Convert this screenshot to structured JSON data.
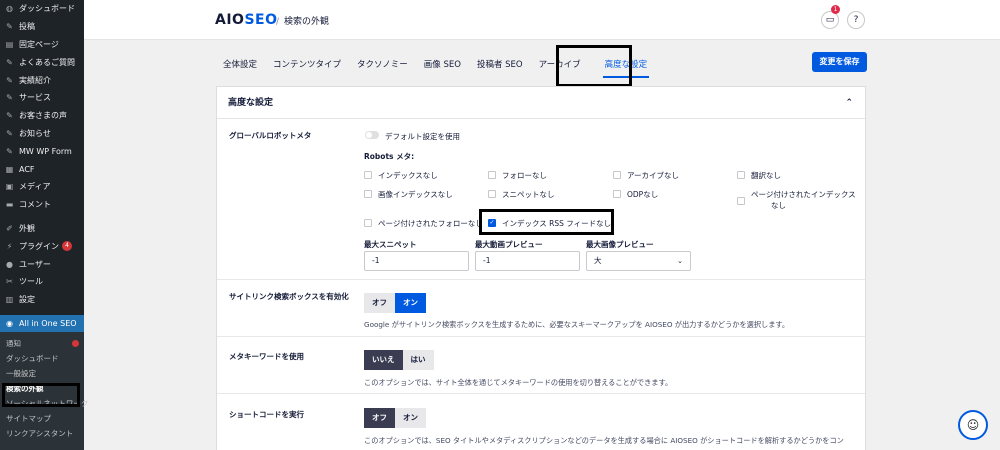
{
  "wp_menu": {
    "items": [
      {
        "label": "ダッシュボード",
        "icon": "dashboard-icon",
        "glyph": "◍"
      },
      {
        "label": "投稿",
        "icon": "pin-icon",
        "glyph": "✎"
      },
      {
        "label": "固定ページ",
        "icon": "page-icon",
        "glyph": "▤"
      },
      {
        "label": "よくあるご質問",
        "icon": "pin-icon",
        "glyph": "✎"
      },
      {
        "label": "実績紹介",
        "icon": "pin-icon",
        "glyph": "✎"
      },
      {
        "label": "サービス",
        "icon": "pin-icon",
        "glyph": "✎"
      },
      {
        "label": "お客さまの声",
        "icon": "pin-icon",
        "glyph": "✎"
      },
      {
        "label": "お知らせ",
        "icon": "pin-icon",
        "glyph": "✎"
      },
      {
        "label": "MW WP Form",
        "icon": "pin-icon",
        "glyph": "✎"
      },
      {
        "label": "ACF",
        "icon": "acf-icon",
        "glyph": "▦"
      },
      {
        "label": "メディア",
        "icon": "media-icon",
        "glyph": "▣"
      },
      {
        "label": "コメント",
        "icon": "comment-icon",
        "glyph": "▬"
      },
      {
        "label": "外観",
        "icon": "appearance-icon",
        "glyph": "✐"
      },
      {
        "label": "プラグイン",
        "icon": "plugin-icon",
        "glyph": "⚡",
        "badge": "4"
      },
      {
        "label": "ユーザー",
        "icon": "user-icon",
        "glyph": "●"
      },
      {
        "label": "ツール",
        "icon": "tool-icon",
        "glyph": "✂"
      },
      {
        "label": "設定",
        "icon": "settings-icon",
        "glyph": "▥"
      },
      {
        "label": "All in One SEO",
        "icon": "aioseo-icon",
        "glyph": "◉"
      }
    ],
    "submenu": [
      "通知",
      "ダッシュボード",
      "一般設定",
      "検索の外観",
      "ソーシャルネットワーク",
      "サイトマップ",
      "リンクアシスタント"
    ]
  },
  "header": {
    "logo_main": "AIO",
    "logo_accent": "SEO",
    "separator": "/",
    "breadcrumb": "検索の外観",
    "notification_count": "1",
    "inbox_glyph": "▭",
    "help_glyph": "?"
  },
  "tabs": [
    "全体設定",
    "コンテンツタイプ",
    "タクソノミー",
    "画像 SEO",
    "投稿者 SEO",
    "アーカイブ",
    "高度な設定"
  ],
  "save_button": "変更を保存",
  "card": {
    "title": "高度な設定",
    "collapse_glyph": "⌃",
    "robots": {
      "label": "グローバルロボットメタ",
      "default_toggle": "デフォルト設定を使用",
      "robots_label": "Robots メタ:",
      "checkboxes": [
        {
          "label": "インデックスなし",
          "checked": false
        },
        {
          "label": "フォローなし",
          "checked": false
        },
        {
          "label": "アーカイブなし",
          "checked": false
        },
        {
          "label": "翻訳なし",
          "checked": false
        },
        {
          "label": "画像インデックスなし",
          "checked": false
        },
        {
          "label": "スニペットなし",
          "checked": false
        },
        {
          "label": "ODPなし",
          "checked": false
        },
        {
          "label": "ページ付けされたインデックス",
          "label2": "なし",
          "checked": false
        },
        {
          "label": "ページ付けされたフォローなし",
          "checked": false
        },
        {
          "label": "インデックス RSS フィードなし",
          "checked": true
        }
      ],
      "max_snippet_label": "最大スニペット",
      "max_snippet_value": "-1",
      "max_video_label": "最大動画プレビュー",
      "max_video_value": "-1",
      "max_image_label": "最大画像プレビュー",
      "max_image_value": "大",
      "dropdown_glyph": "⌄"
    },
    "sitelinks": {
      "label": "サイトリンク検索ボックスを有効化",
      "off": "オフ",
      "on": "オン",
      "help": "Google がサイトリンク検索ボックスを生成するために、必要なスキーマークアップを AIOSEO が出力するかどうかを選択します。"
    },
    "meta_keywords": {
      "label": "メタキーワードを使用",
      "no": "いいえ",
      "yes": "はい",
      "help": "このオプションでは、サイト全体を通じてメタキーワードの使用を切り替えることができます。"
    },
    "shortcodes": {
      "label": "ショートコードを実行",
      "off": "オフ",
      "on": "オン",
      "help": "このオプションでは、SEO タイトルやメタディスクリプションなどのデータを生成する場合に AIOSEO がショートコードを解析するかどうかをコン"
    }
  },
  "mascot_glyph": "☺",
  "colors": {
    "accent": "#005ae0",
    "sidebar": "#1d2327",
    "active_menu": "#2271b1"
  }
}
